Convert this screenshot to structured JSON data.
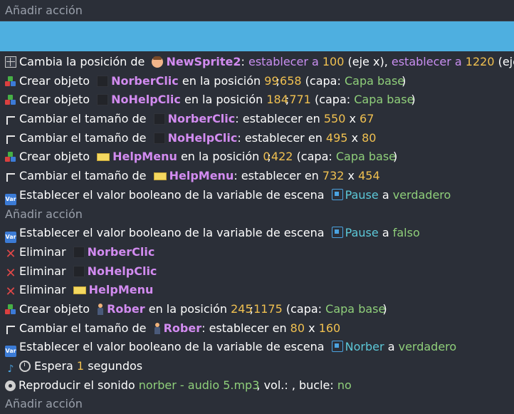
{
  "top_add_action": "Añadir acción",
  "mid_add_action": "Añadir acción",
  "bottom_add_action": "Añadir acción",
  "rows": [
    {
      "p": [
        "Cambia la posición de",
        "NewSprite2",
        ":",
        "establecer a",
        "100",
        "(eje x),",
        "establecer a",
        "1220",
        "(eje y)"
      ]
    },
    {
      "p": [
        "Crear objeto",
        "NorberClic",
        "en la posición",
        "99",
        ";",
        "658",
        "(capa:",
        "Capa base",
        ")"
      ]
    },
    {
      "p": [
        "Crear objeto",
        "NoHelpClic",
        "en la posición",
        "184",
        ";",
        "771",
        "(capa:",
        "Capa base",
        ")"
      ]
    },
    {
      "p": [
        "Cambiar el tamaño de",
        "NorberClic",
        ": establecer en",
        "550",
        "x",
        "67"
      ]
    },
    {
      "p": [
        "Cambiar el tamaño de",
        "NoHelpClic",
        ": establecer en",
        "495",
        "x",
        "80"
      ]
    },
    {
      "p": [
        "Crear objeto",
        "HelpMenu",
        "en la posición",
        "0",
        ";",
        "422",
        "(capa:",
        "Capa base",
        ")"
      ]
    },
    {
      "p": [
        "Cambiar el tamaño de",
        "HelpMenu",
        ": establecer en",
        "732",
        "x",
        "454"
      ]
    },
    {
      "p": [
        "Establecer el valor booleano de la variable de escena",
        "Pause",
        "a",
        "verdadero"
      ]
    }
  ],
  "rows2": [
    {
      "p": [
        "Establecer el valor booleano de la variable de escena",
        "Pause",
        "a",
        "falso"
      ]
    },
    {
      "p": [
        "Eliminar",
        "NorberClic"
      ]
    },
    {
      "p": [
        "Eliminar",
        "NoHelpClic"
      ]
    },
    {
      "p": [
        "Eliminar",
        "HelpMenu"
      ]
    },
    {
      "p": [
        "Crear objeto",
        "Rober",
        "en la posición",
        "245",
        ";",
        "1175",
        "(capa:",
        "Capa base",
        ")"
      ]
    },
    {
      "p": [
        "Cambiar el tamaño de",
        "Rober",
        ": establecer en",
        "80",
        "x",
        "160"
      ]
    },
    {
      "p": [
        "Establecer el valor booleano de la variable de escena",
        "Norber",
        "a",
        "verdadero"
      ]
    },
    {
      "p": [
        "Espera",
        "1",
        "segundos"
      ]
    },
    {
      "p": [
        "Reproducir el sonido",
        "norber - audio 5.mp3",
        ", vol.: , bucle:",
        "no"
      ]
    }
  ],
  "icons": {
    "move": "move-icon",
    "create": "create-object-icon",
    "resize": "resize-icon",
    "variable": "variable-icon",
    "delete": "delete-icon",
    "wait": "wait-icon",
    "sound": "sound-icon"
  },
  "colors": {
    "background": "#2b2f38",
    "selection": "#4eafe0",
    "object_name": "#d28bf0",
    "number": "#f0c050",
    "string": "#8fcf7a",
    "variable": "#5cc8d8",
    "header_text": "#9aa0ab"
  }
}
